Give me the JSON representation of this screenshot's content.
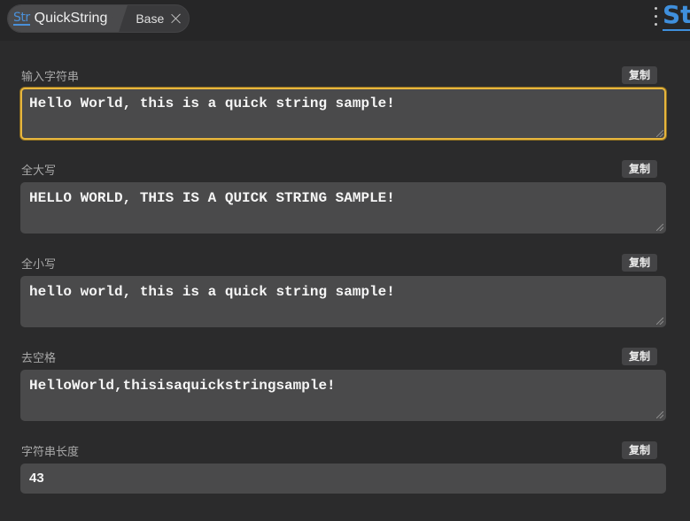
{
  "tabs": {
    "active": {
      "logo": "Str",
      "label": "QuickString"
    },
    "inactive": {
      "label": "Base"
    }
  },
  "corner_logo": "Str",
  "sections": [
    {
      "label": "输入字符串",
      "copy": "复制",
      "value": "Hello World, this is a quick string sample!"
    },
    {
      "label": "全大写",
      "copy": "复制",
      "value": "HELLO WORLD, THIS IS A QUICK STRING SAMPLE!"
    },
    {
      "label": "全小写",
      "copy": "复制",
      "value": "hello world, this is a quick string sample!"
    },
    {
      "label": "去空格",
      "copy": "复制",
      "value": "HelloWorld,thisisaquickstringsample!"
    },
    {
      "label": "字符串长度",
      "copy": "复制",
      "value": "43"
    }
  ],
  "colors": {
    "accent": "#3f8fdc",
    "focus_border": "#e7b63d",
    "background": "#2b2b2c"
  }
}
